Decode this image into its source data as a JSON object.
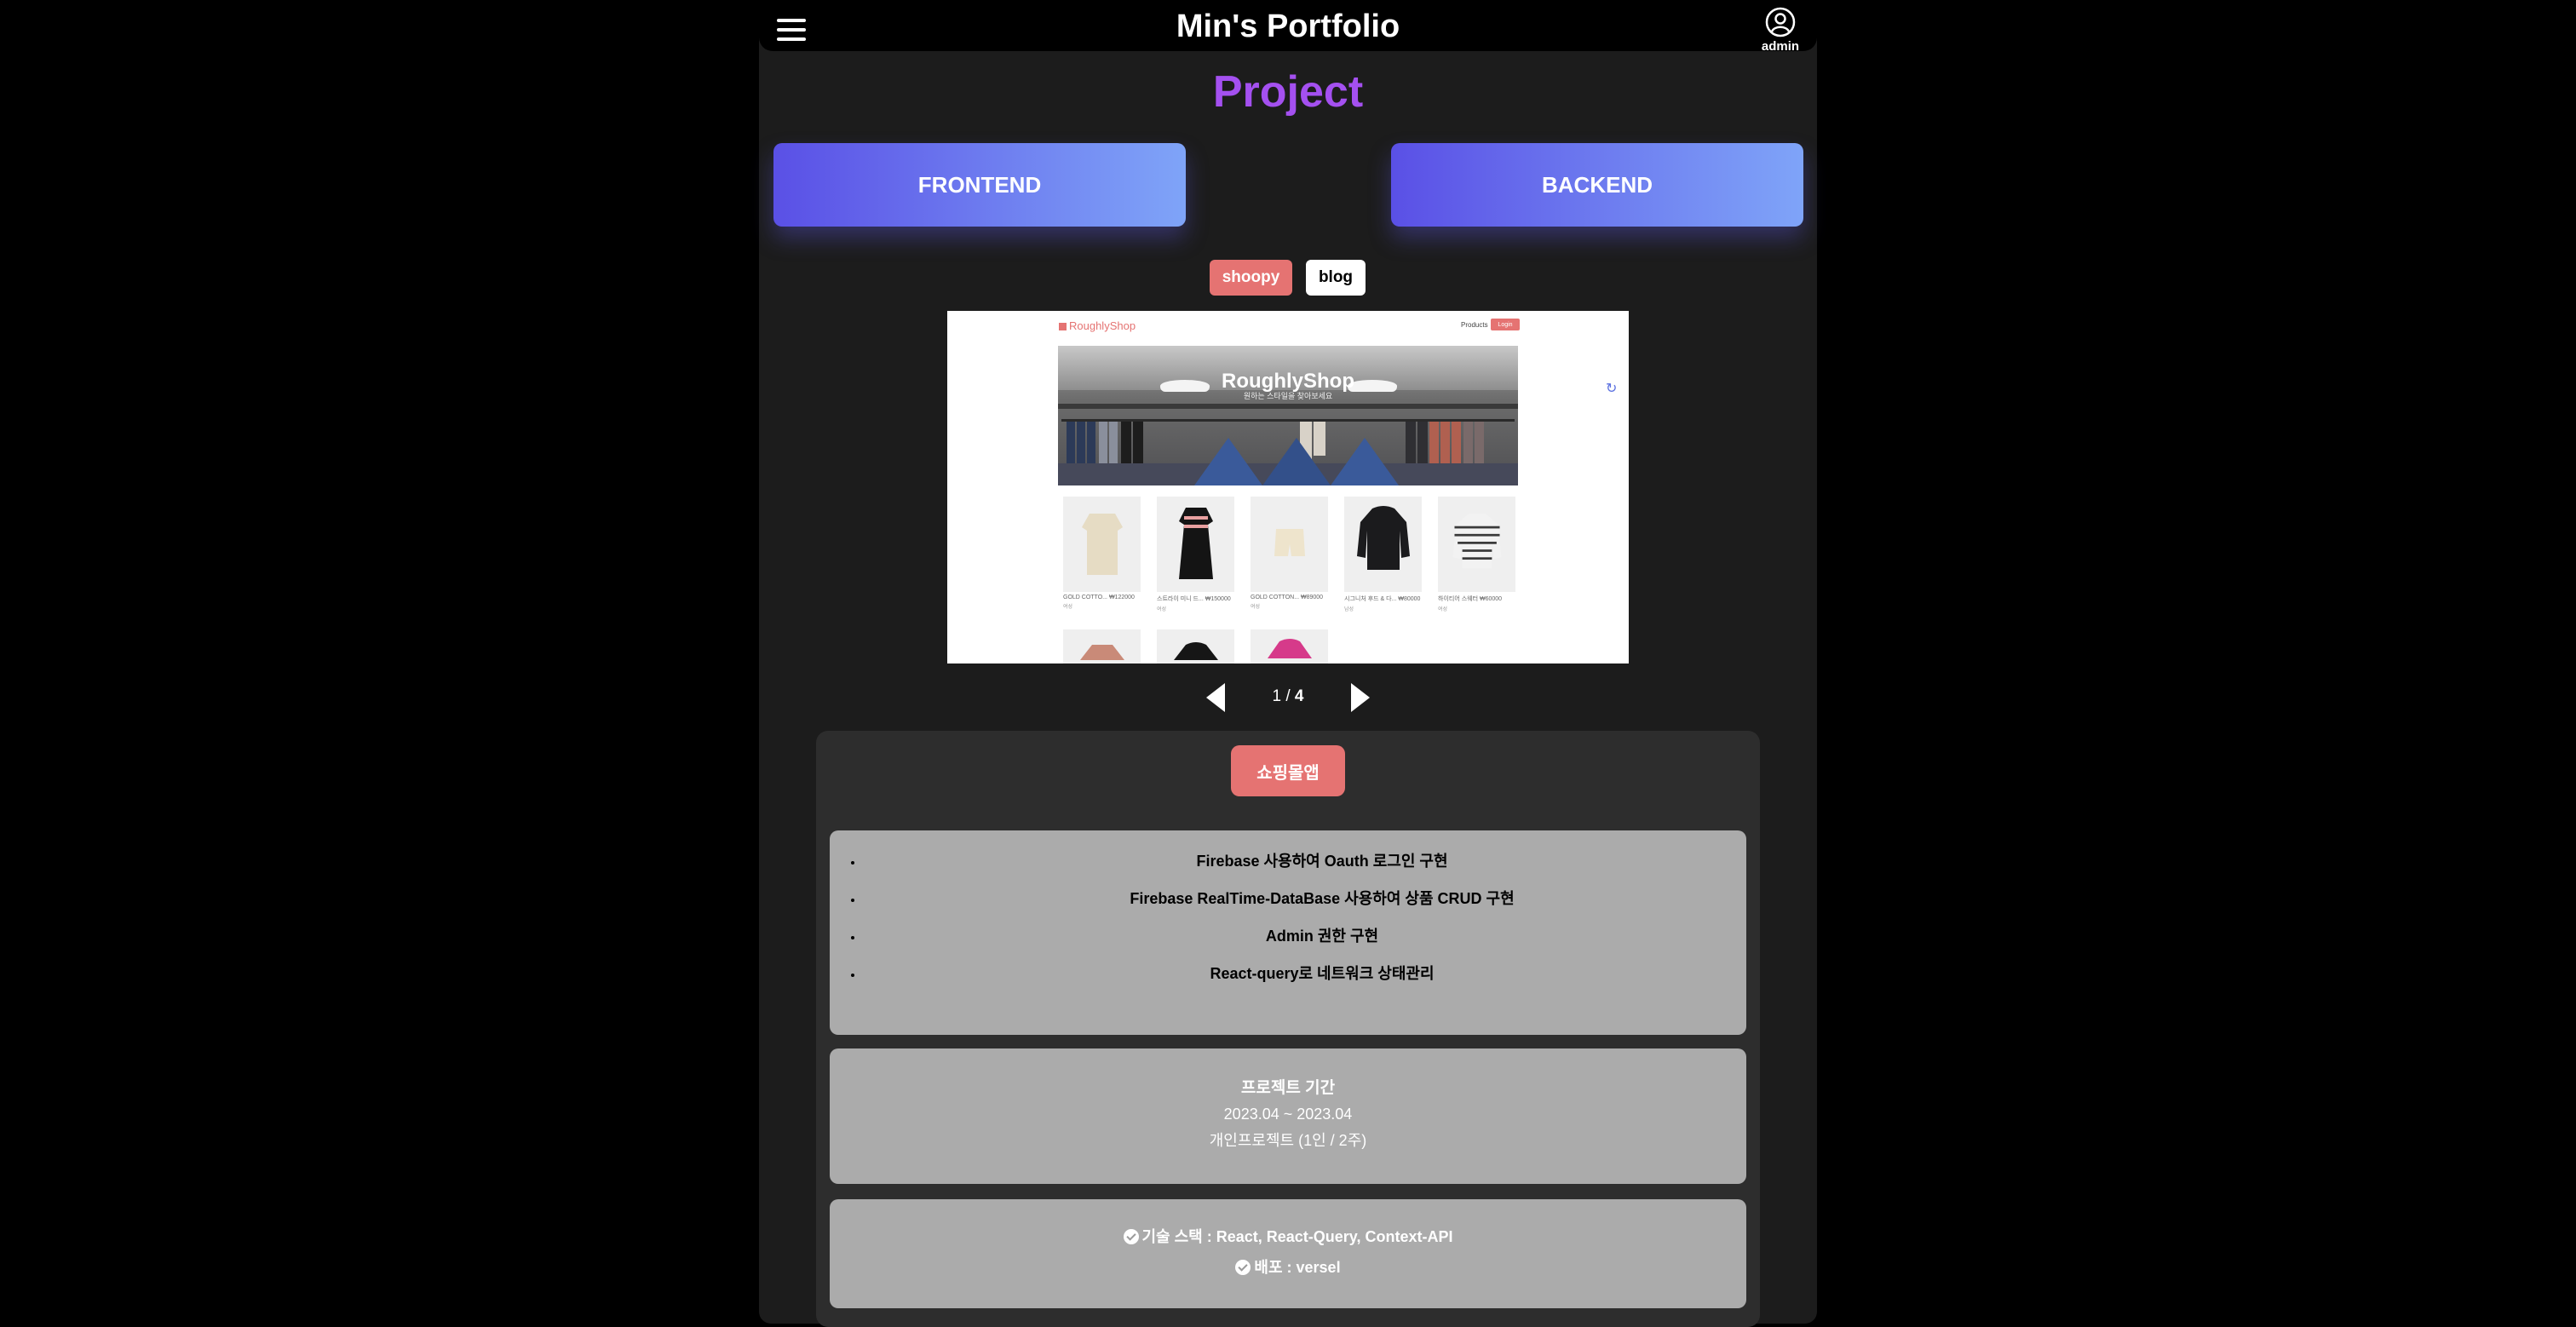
{
  "header": {
    "brand": "Min's Portfolio",
    "user_label": "admin"
  },
  "page": {
    "title": "Project"
  },
  "categories": [
    {
      "label": "FRONTEND"
    },
    {
      "label": "BACKEND"
    }
  ],
  "projects": [
    {
      "label": "shoopy",
      "selected": true
    },
    {
      "label": "blog",
      "selected": false
    }
  ],
  "preview": {
    "logo": "RoughlyShop",
    "nav_products": "Products",
    "nav_login": "Login",
    "banner_title": "RoughlyShop",
    "banner_subtitle": "원하는 스타일을 찾아보세요",
    "products": [
      {
        "name": "GOLD COTTO...",
        "price": "₩122000",
        "tag": "여성"
      },
      {
        "name": "스트라이 미니 드...",
        "price": "₩150000",
        "tag": "여성"
      },
      {
        "name": "GOLD COTTON...",
        "price": "₩89000",
        "tag": "여성"
      },
      {
        "name": "시그니처 후드 & 다...",
        "price": "₩80000",
        "tag": "남성"
      },
      {
        "name": "하이티어 스웨터",
        "price": "₩60000",
        "tag": "여성"
      }
    ]
  },
  "pager": {
    "current": "1",
    "separator": "/",
    "total": "4"
  },
  "detail": {
    "badge": "쇼핑몰앱",
    "features": [
      "Firebase 사용하여 Oauth 로그인 구현",
      "Firebase RealTime-DataBase 사용하여 상품 CRUD 구현",
      "Admin 권한 구현",
      "React-query로 네트워크 상태관리"
    ],
    "period_title": "프로젝트 기간",
    "period_range": "2023.04 ~ 2023.04",
    "period_note": "개인프로젝트 (1인 / 2주)",
    "stack_label": "기술 스택 : React, React-Query, Context-API",
    "deploy_label": "배포 : versel"
  },
  "colors": {
    "title_purple": "#a450f0",
    "accent_red": "#e57372",
    "gradient_start": "#5a50e6",
    "gradient_end": "#7fa4f8",
    "panel_gray": "#ababab"
  }
}
